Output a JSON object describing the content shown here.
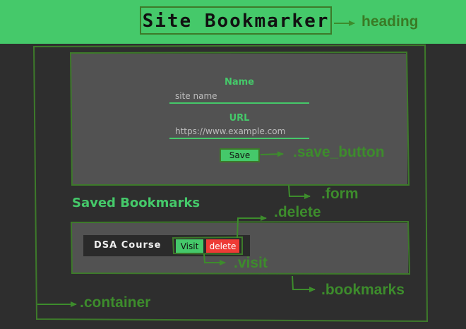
{
  "header": {
    "title": "Site Bookmarker"
  },
  "form": {
    "name_label": "Name",
    "name_placeholder": "site name",
    "url_label": "URL",
    "url_placeholder": "https://www.example.com",
    "save_label": "Save"
  },
  "bookmarks": {
    "section_title": "Saved Bookmarks",
    "items": [
      {
        "name": "DSA Course",
        "visit_label": "Visit",
        "delete_label": "delete"
      }
    ]
  },
  "annotations": {
    "heading": "heading",
    "save_button": ".save_button",
    "form": ".form",
    "delete": ".delete",
    "visit": ".visit",
    "bookmarks": ".bookmarks",
    "container": ".container"
  },
  "colors": {
    "accent": "#45c96a",
    "background": "#2e2e2e",
    "panel": "#525252",
    "annotation": "#3d8c2c",
    "delete": "#ee3b36"
  }
}
